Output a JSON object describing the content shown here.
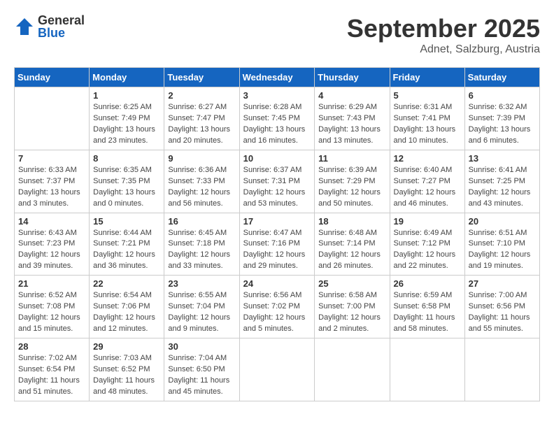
{
  "logo": {
    "general": "General",
    "blue": "Blue"
  },
  "title": {
    "month": "September 2025",
    "location": "Adnet, Salzburg, Austria"
  },
  "headers": [
    "Sunday",
    "Monday",
    "Tuesday",
    "Wednesday",
    "Thursday",
    "Friday",
    "Saturday"
  ],
  "weeks": [
    [
      {
        "day": "",
        "info": ""
      },
      {
        "day": "1",
        "info": "Sunrise: 6:25 AM\nSunset: 7:49 PM\nDaylight: 13 hours\nand 23 minutes."
      },
      {
        "day": "2",
        "info": "Sunrise: 6:27 AM\nSunset: 7:47 PM\nDaylight: 13 hours\nand 20 minutes."
      },
      {
        "day": "3",
        "info": "Sunrise: 6:28 AM\nSunset: 7:45 PM\nDaylight: 13 hours\nand 16 minutes."
      },
      {
        "day": "4",
        "info": "Sunrise: 6:29 AM\nSunset: 7:43 PM\nDaylight: 13 hours\nand 13 minutes."
      },
      {
        "day": "5",
        "info": "Sunrise: 6:31 AM\nSunset: 7:41 PM\nDaylight: 13 hours\nand 10 minutes."
      },
      {
        "day": "6",
        "info": "Sunrise: 6:32 AM\nSunset: 7:39 PM\nDaylight: 13 hours\nand 6 minutes."
      }
    ],
    [
      {
        "day": "7",
        "info": "Sunrise: 6:33 AM\nSunset: 7:37 PM\nDaylight: 13 hours\nand 3 minutes."
      },
      {
        "day": "8",
        "info": "Sunrise: 6:35 AM\nSunset: 7:35 PM\nDaylight: 13 hours\nand 0 minutes."
      },
      {
        "day": "9",
        "info": "Sunrise: 6:36 AM\nSunset: 7:33 PM\nDaylight: 12 hours\nand 56 minutes."
      },
      {
        "day": "10",
        "info": "Sunrise: 6:37 AM\nSunset: 7:31 PM\nDaylight: 12 hours\nand 53 minutes."
      },
      {
        "day": "11",
        "info": "Sunrise: 6:39 AM\nSunset: 7:29 PM\nDaylight: 12 hours\nand 50 minutes."
      },
      {
        "day": "12",
        "info": "Sunrise: 6:40 AM\nSunset: 7:27 PM\nDaylight: 12 hours\nand 46 minutes."
      },
      {
        "day": "13",
        "info": "Sunrise: 6:41 AM\nSunset: 7:25 PM\nDaylight: 12 hours\nand 43 minutes."
      }
    ],
    [
      {
        "day": "14",
        "info": "Sunrise: 6:43 AM\nSunset: 7:23 PM\nDaylight: 12 hours\nand 39 minutes."
      },
      {
        "day": "15",
        "info": "Sunrise: 6:44 AM\nSunset: 7:21 PM\nDaylight: 12 hours\nand 36 minutes."
      },
      {
        "day": "16",
        "info": "Sunrise: 6:45 AM\nSunset: 7:18 PM\nDaylight: 12 hours\nand 33 minutes."
      },
      {
        "day": "17",
        "info": "Sunrise: 6:47 AM\nSunset: 7:16 PM\nDaylight: 12 hours\nand 29 minutes."
      },
      {
        "day": "18",
        "info": "Sunrise: 6:48 AM\nSunset: 7:14 PM\nDaylight: 12 hours\nand 26 minutes."
      },
      {
        "day": "19",
        "info": "Sunrise: 6:49 AM\nSunset: 7:12 PM\nDaylight: 12 hours\nand 22 minutes."
      },
      {
        "day": "20",
        "info": "Sunrise: 6:51 AM\nSunset: 7:10 PM\nDaylight: 12 hours\nand 19 minutes."
      }
    ],
    [
      {
        "day": "21",
        "info": "Sunrise: 6:52 AM\nSunset: 7:08 PM\nDaylight: 12 hours\nand 15 minutes."
      },
      {
        "day": "22",
        "info": "Sunrise: 6:54 AM\nSunset: 7:06 PM\nDaylight: 12 hours\nand 12 minutes."
      },
      {
        "day": "23",
        "info": "Sunrise: 6:55 AM\nSunset: 7:04 PM\nDaylight: 12 hours\nand 9 minutes."
      },
      {
        "day": "24",
        "info": "Sunrise: 6:56 AM\nSunset: 7:02 PM\nDaylight: 12 hours\nand 5 minutes."
      },
      {
        "day": "25",
        "info": "Sunrise: 6:58 AM\nSunset: 7:00 PM\nDaylight: 12 hours\nand 2 minutes."
      },
      {
        "day": "26",
        "info": "Sunrise: 6:59 AM\nSunset: 6:58 PM\nDaylight: 11 hours\nand 58 minutes."
      },
      {
        "day": "27",
        "info": "Sunrise: 7:00 AM\nSunset: 6:56 PM\nDaylight: 11 hours\nand 55 minutes."
      }
    ],
    [
      {
        "day": "28",
        "info": "Sunrise: 7:02 AM\nSunset: 6:54 PM\nDaylight: 11 hours\nand 51 minutes."
      },
      {
        "day": "29",
        "info": "Sunrise: 7:03 AM\nSunset: 6:52 PM\nDaylight: 11 hours\nand 48 minutes."
      },
      {
        "day": "30",
        "info": "Sunrise: 7:04 AM\nSunset: 6:50 PM\nDaylight: 11 hours\nand 45 minutes."
      },
      {
        "day": "",
        "info": ""
      },
      {
        "day": "",
        "info": ""
      },
      {
        "day": "",
        "info": ""
      },
      {
        "day": "",
        "info": ""
      }
    ]
  ]
}
